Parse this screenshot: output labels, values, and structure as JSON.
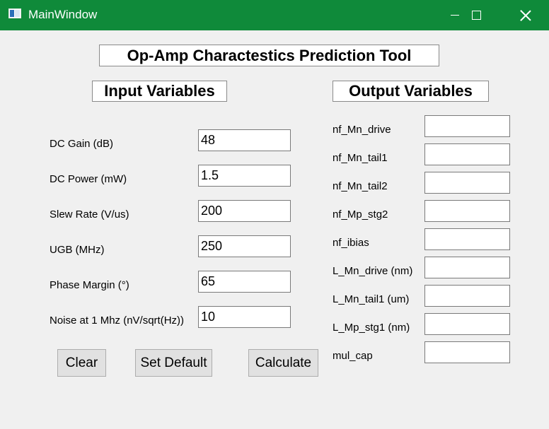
{
  "window": {
    "title": "MainWindow"
  },
  "header": {
    "title": "Op-Amp Charactestics Prediction Tool"
  },
  "inputs": {
    "title": "Input Variables",
    "items": [
      {
        "label": "DC Gain (dB)",
        "value": "48"
      },
      {
        "label": "DC Power (mW)",
        "value": "1.5"
      },
      {
        "label": "Slew Rate (V/us)",
        "value": "200"
      },
      {
        "label": "UGB (MHz)",
        "value": "250"
      },
      {
        "label": "Phase Margin (°)",
        "value": "65"
      },
      {
        "label": "Noise at 1 Mhz (nV/sqrt(Hz))",
        "value": "10"
      }
    ]
  },
  "outputs": {
    "title": "Output Variables",
    "items": [
      {
        "label": "nf_Mn_drive",
        "value": ""
      },
      {
        "label": "nf_Mn_tail1",
        "value": ""
      },
      {
        "label": "nf_Mn_tail2",
        "value": ""
      },
      {
        "label": "nf_Mp_stg2",
        "value": ""
      },
      {
        "label": "nf_ibias",
        "value": ""
      },
      {
        "label": "L_Mn_drive (nm)",
        "value": ""
      },
      {
        "label": "L_Mn_tail1 (um)",
        "value": ""
      },
      {
        "label": "L_Mp_stg1 (nm)",
        "value": ""
      },
      {
        "label": "mul_cap",
        "value": ""
      }
    ]
  },
  "buttons": {
    "clear": "Clear",
    "set_default": "Set Default",
    "calculate": "Calculate"
  },
  "colors": {
    "titlebar": "#0f8a3a",
    "background": "#f0f0f0"
  }
}
